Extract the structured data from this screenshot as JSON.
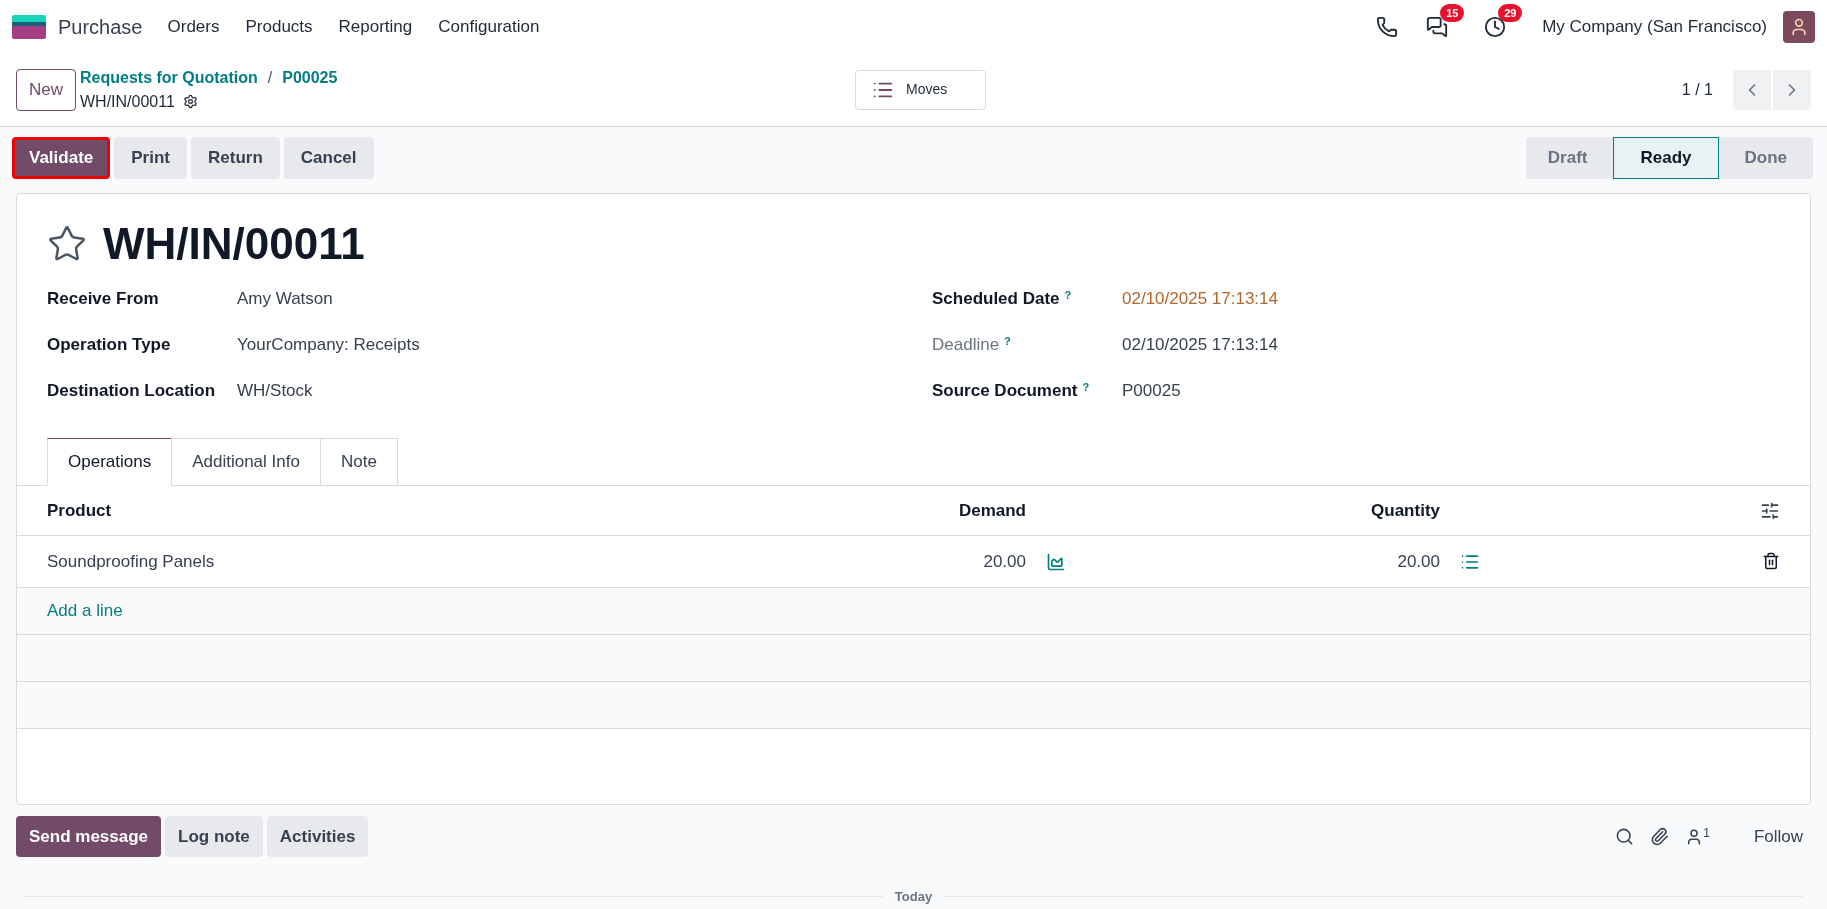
{
  "navbar": {
    "app_name": "Purchase",
    "menu": [
      "Orders",
      "Products",
      "Reporting",
      "Configuration"
    ],
    "badges": [
      {
        "kind": "messages",
        "count": "15"
      },
      {
        "kind": "activities",
        "count": "29"
      }
    ],
    "company": "My Company (San Francisco)"
  },
  "control_panel": {
    "new_button": "New",
    "breadcrumbs": [
      "Requests for Quotation",
      "P00025"
    ],
    "breadcrumb_separator": "/",
    "current": "WH/IN/00011",
    "moves_button": "Moves",
    "pager": "1 / 1"
  },
  "actions": [
    {
      "label": "Validate",
      "primary": true,
      "highlighted": true
    },
    {
      "label": "Print",
      "primary": false,
      "highlighted": false
    },
    {
      "label": "Return",
      "primary": false,
      "highlighted": false
    },
    {
      "label": "Cancel",
      "primary": false,
      "highlighted": false
    }
  ],
  "stages": [
    {
      "label": "Draft",
      "selected": false
    },
    {
      "label": "Ready",
      "selected": true
    },
    {
      "label": "Done",
      "selected": false
    }
  ],
  "record": {
    "title": "WH/IN/00011",
    "starred": false
  },
  "left_fields": [
    {
      "label": "Receive From",
      "value": "Amy Watson",
      "muted": false,
      "warning": false
    },
    {
      "label": "Operation Type",
      "value": "YourCompany: Receipts",
      "muted": false,
      "warning": false
    },
    {
      "label": "Destination Location",
      "value": "WH/Stock",
      "muted": false,
      "warning": false
    }
  ],
  "right_fields": [
    {
      "label": "Scheduled Date",
      "help": "?",
      "value": "02/10/2025 17:13:14",
      "muted": false,
      "warning": true
    },
    {
      "label": "Deadline",
      "help": "?",
      "value": "02/10/2025 17:13:14",
      "muted": true,
      "warning": false
    },
    {
      "label": "Source Document",
      "help": "?",
      "value": "P00025",
      "muted": false,
      "warning": false
    }
  ],
  "tabs": [
    {
      "label": "Operations",
      "selected": true
    },
    {
      "label": "Additional Info",
      "selected": false
    },
    {
      "label": "Note",
      "selected": false
    }
  ],
  "table": {
    "columns": [
      "Product",
      "Demand",
      "Quantity"
    ],
    "rows": [
      {
        "product": "Soundproofing Panels",
        "demand": "20.00",
        "quantity": "20.00"
      }
    ],
    "add_line": "Add a line"
  },
  "chatter": {
    "buttons": [
      {
        "label": "Send message",
        "primary": true
      },
      {
        "label": "Log note",
        "primary": false
      },
      {
        "label": "Activities",
        "primary": false
      }
    ],
    "followers_count": "1",
    "follow": "Follow",
    "separator": "Today"
  }
}
